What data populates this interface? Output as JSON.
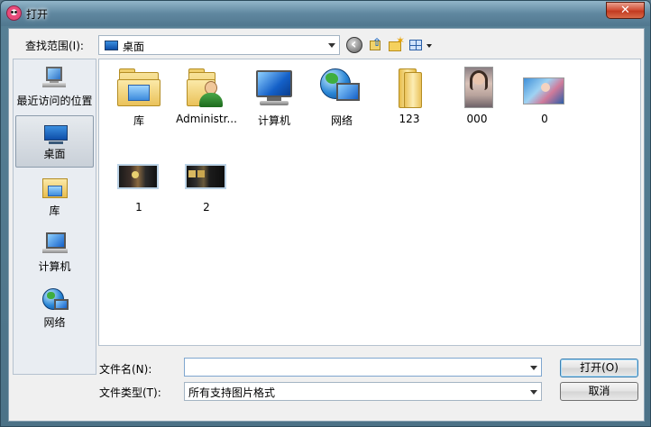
{
  "window": {
    "title": "打开",
    "close_label": "✕"
  },
  "toolbar": {
    "look_in_label": "查找范围(I):",
    "look_in_value": "桌面"
  },
  "places": [
    {
      "label": "最近访问的位置"
    },
    {
      "label": "桌面"
    },
    {
      "label": "库"
    },
    {
      "label": "计算机"
    },
    {
      "label": "网络"
    }
  ],
  "files": [
    {
      "name": "库"
    },
    {
      "name": "Administr..."
    },
    {
      "name": "计算机"
    },
    {
      "name": "网络"
    },
    {
      "name": "123"
    },
    {
      "name": "000"
    },
    {
      "name": "0"
    },
    {
      "name": "1"
    },
    {
      "name": "2"
    }
  ],
  "bottom": {
    "filename_label": "文件名(N):",
    "filename_value": "",
    "filetype_label": "文件类型(T):",
    "filetype_value": "所有支持图片格式",
    "open_label": "打开(O)",
    "cancel_label": "取消"
  }
}
